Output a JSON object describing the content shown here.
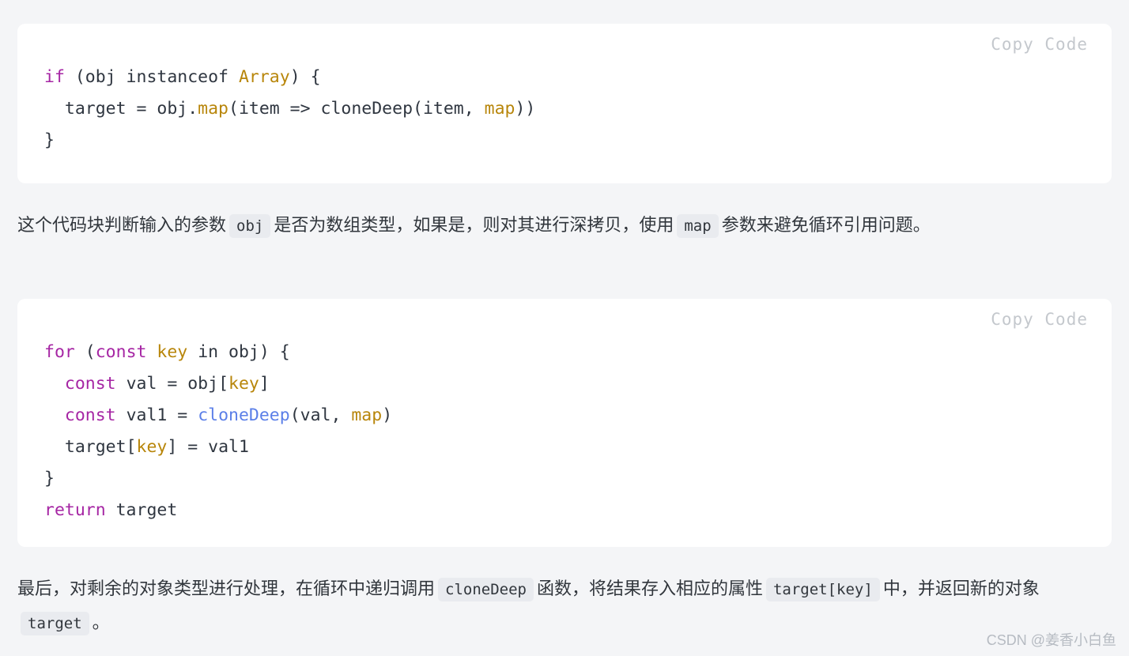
{
  "page": {
    "background_color": "#f4f5f7",
    "text_color": "#31363c"
  },
  "code_blocks": [
    {
      "id": "code-block-1",
      "copy_label": "Copy Code",
      "language": "javascript",
      "lines": [
        [
          {
            "t": "if",
            "c": "key"
          },
          {
            "t": " (obj instanceof ",
            "c": "txt"
          },
          {
            "t": "Array",
            "c": "var"
          },
          {
            "t": ") {",
            "c": "txt"
          }
        ],
        [
          {
            "t": "  target = obj.",
            "c": "txt"
          },
          {
            "t": "map",
            "c": "var"
          },
          {
            "t": "(item => cloneDeep(item, ",
            "c": "txt"
          },
          {
            "t": "map",
            "c": "var"
          },
          {
            "t": "))",
            "c": "txt"
          }
        ],
        [
          {
            "t": "}",
            "c": "txt"
          }
        ]
      ]
    },
    {
      "id": "code-block-2",
      "copy_label": "Copy Code",
      "language": "javascript",
      "lines": [
        [
          {
            "t": "for",
            "c": "key"
          },
          {
            "t": " (",
            "c": "txt"
          },
          {
            "t": "const",
            "c": "key"
          },
          {
            "t": " ",
            "c": "txt"
          },
          {
            "t": "key",
            "c": "var"
          },
          {
            "t": " in obj) {",
            "c": "txt"
          }
        ],
        [
          {
            "t": "  ",
            "c": "txt"
          },
          {
            "t": "const",
            "c": "key"
          },
          {
            "t": " val = obj[",
            "c": "txt"
          },
          {
            "t": "key",
            "c": "var"
          },
          {
            "t": "]",
            "c": "txt"
          }
        ],
        [
          {
            "t": "  ",
            "c": "txt"
          },
          {
            "t": "const",
            "c": "key"
          },
          {
            "t": " val1 = ",
            "c": "txt"
          },
          {
            "t": "cloneDeep",
            "c": "fn"
          },
          {
            "t": "(val, ",
            "c": "txt"
          },
          {
            "t": "map",
            "c": "var"
          },
          {
            "t": ")",
            "c": "txt"
          }
        ],
        [
          {
            "t": "  target[",
            "c": "txt"
          },
          {
            "t": "key",
            "c": "var"
          },
          {
            "t": "] = val1",
            "c": "txt"
          }
        ],
        [
          {
            "t": "}",
            "c": "txt"
          }
        ],
        [
          {
            "t": "return",
            "c": "key"
          },
          {
            "t": " target",
            "c": "txt"
          }
        ]
      ]
    }
  ],
  "paragraphs": [
    {
      "id": "para-1",
      "runs": [
        {
          "type": "text",
          "value": "这个代码块判断输入的参数"
        },
        {
          "type": "code",
          "value": "obj"
        },
        {
          "type": "text",
          "value": "是否为数组类型，如果是，则对其进行深拷贝，使用"
        },
        {
          "type": "code",
          "value": "map"
        },
        {
          "type": "text",
          "value": "参数来避免循环引用问题。"
        }
      ]
    },
    {
      "id": "para-2",
      "runs": [
        {
          "type": "text",
          "value": "最后，对剩余的对象类型进行处理，在循环中递归调用"
        },
        {
          "type": "code",
          "value": "cloneDeep"
        },
        {
          "type": "text",
          "value": "函数，将结果存入相应的属性"
        },
        {
          "type": "code",
          "value": "target[key]"
        },
        {
          "type": "text",
          "value": "中，并返回新的对象"
        },
        {
          "type": "code",
          "value": "target"
        },
        {
          "type": "text",
          "value": "。"
        }
      ]
    }
  ],
  "watermark": {
    "text": "CSDN @姜香小白鱼"
  },
  "colors": {
    "keyword": "#a626a4",
    "variable": "#b8860b",
    "function": "#5b7fe8",
    "plain": "#2f3640",
    "copy_label": "#c4c8cd",
    "inline_code_bg": "#e9ebef",
    "code_block_bg": "#ffffff"
  }
}
